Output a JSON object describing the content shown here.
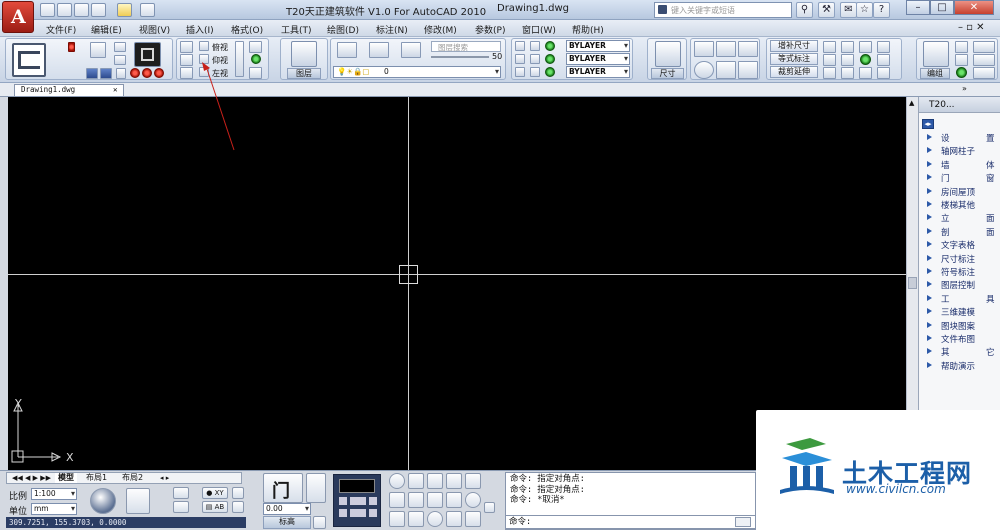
{
  "titlebar": {
    "app_title": "T20天正建筑软件 V1.0 For AutoCAD 2010",
    "document": "Drawing1.dwg",
    "search_placeholder": "键入关键字或短语"
  },
  "menu": [
    "文件(F)",
    "编辑(E)",
    "视图(V)",
    "插入(I)",
    "格式(O)",
    "工具(T)",
    "绘图(D)",
    "标注(N)",
    "修改(M)",
    "参数(P)",
    "窗口(W)",
    "帮助(H)"
  ],
  "ribbon": {
    "view_labels": [
      "俯视",
      "仰视",
      "左视"
    ],
    "layer_search_placeholder": "图层搜索",
    "layer_slider_value": "50",
    "layer_button": "图层",
    "layer_current": "0",
    "bylayer": [
      "BYLAYER",
      "BYLAYER",
      "BYLAYER"
    ],
    "dimension_button": "尺寸",
    "dim_tools": [
      "增补尺寸",
      "等式标注",
      "裁剪延伸"
    ],
    "group_button": "编组"
  },
  "tabs": {
    "document_tab": "Drawing1.dwg"
  },
  "palette": {
    "title": "T20...",
    "items": [
      "设　置",
      "轴网柱子",
      "墙　体",
      "门　窗",
      "房间屋顶",
      "楼梯其他",
      "立　面",
      "剖　面",
      "文字表格",
      "尺寸标注",
      "符号标注",
      "图层控制",
      "工　具",
      "三维建模",
      "图块图案",
      "文件布图",
      "其　它",
      "帮助演示"
    ]
  },
  "ucs": {
    "x": "X",
    "y": "Y"
  },
  "layout_tabs": [
    "模型",
    "布局1",
    "布局2"
  ],
  "statusbar": {
    "scale_label": "比例",
    "scale_value": "1:100",
    "unit_label": "单位",
    "unit_value": "mm",
    "coordinates": "309.7251, 155.3703, 0.0000",
    "elev_value": "0.00",
    "elev_label": "标高",
    "door_icon_text": "门"
  },
  "command": {
    "history": [
      "命令: 指定对角点:",
      "命令: 指定对角点:",
      "命令: *取消*"
    ],
    "prompt": "命令:"
  },
  "watermark": {
    "name": "土木工程网",
    "url": "www.civilcn.com"
  }
}
